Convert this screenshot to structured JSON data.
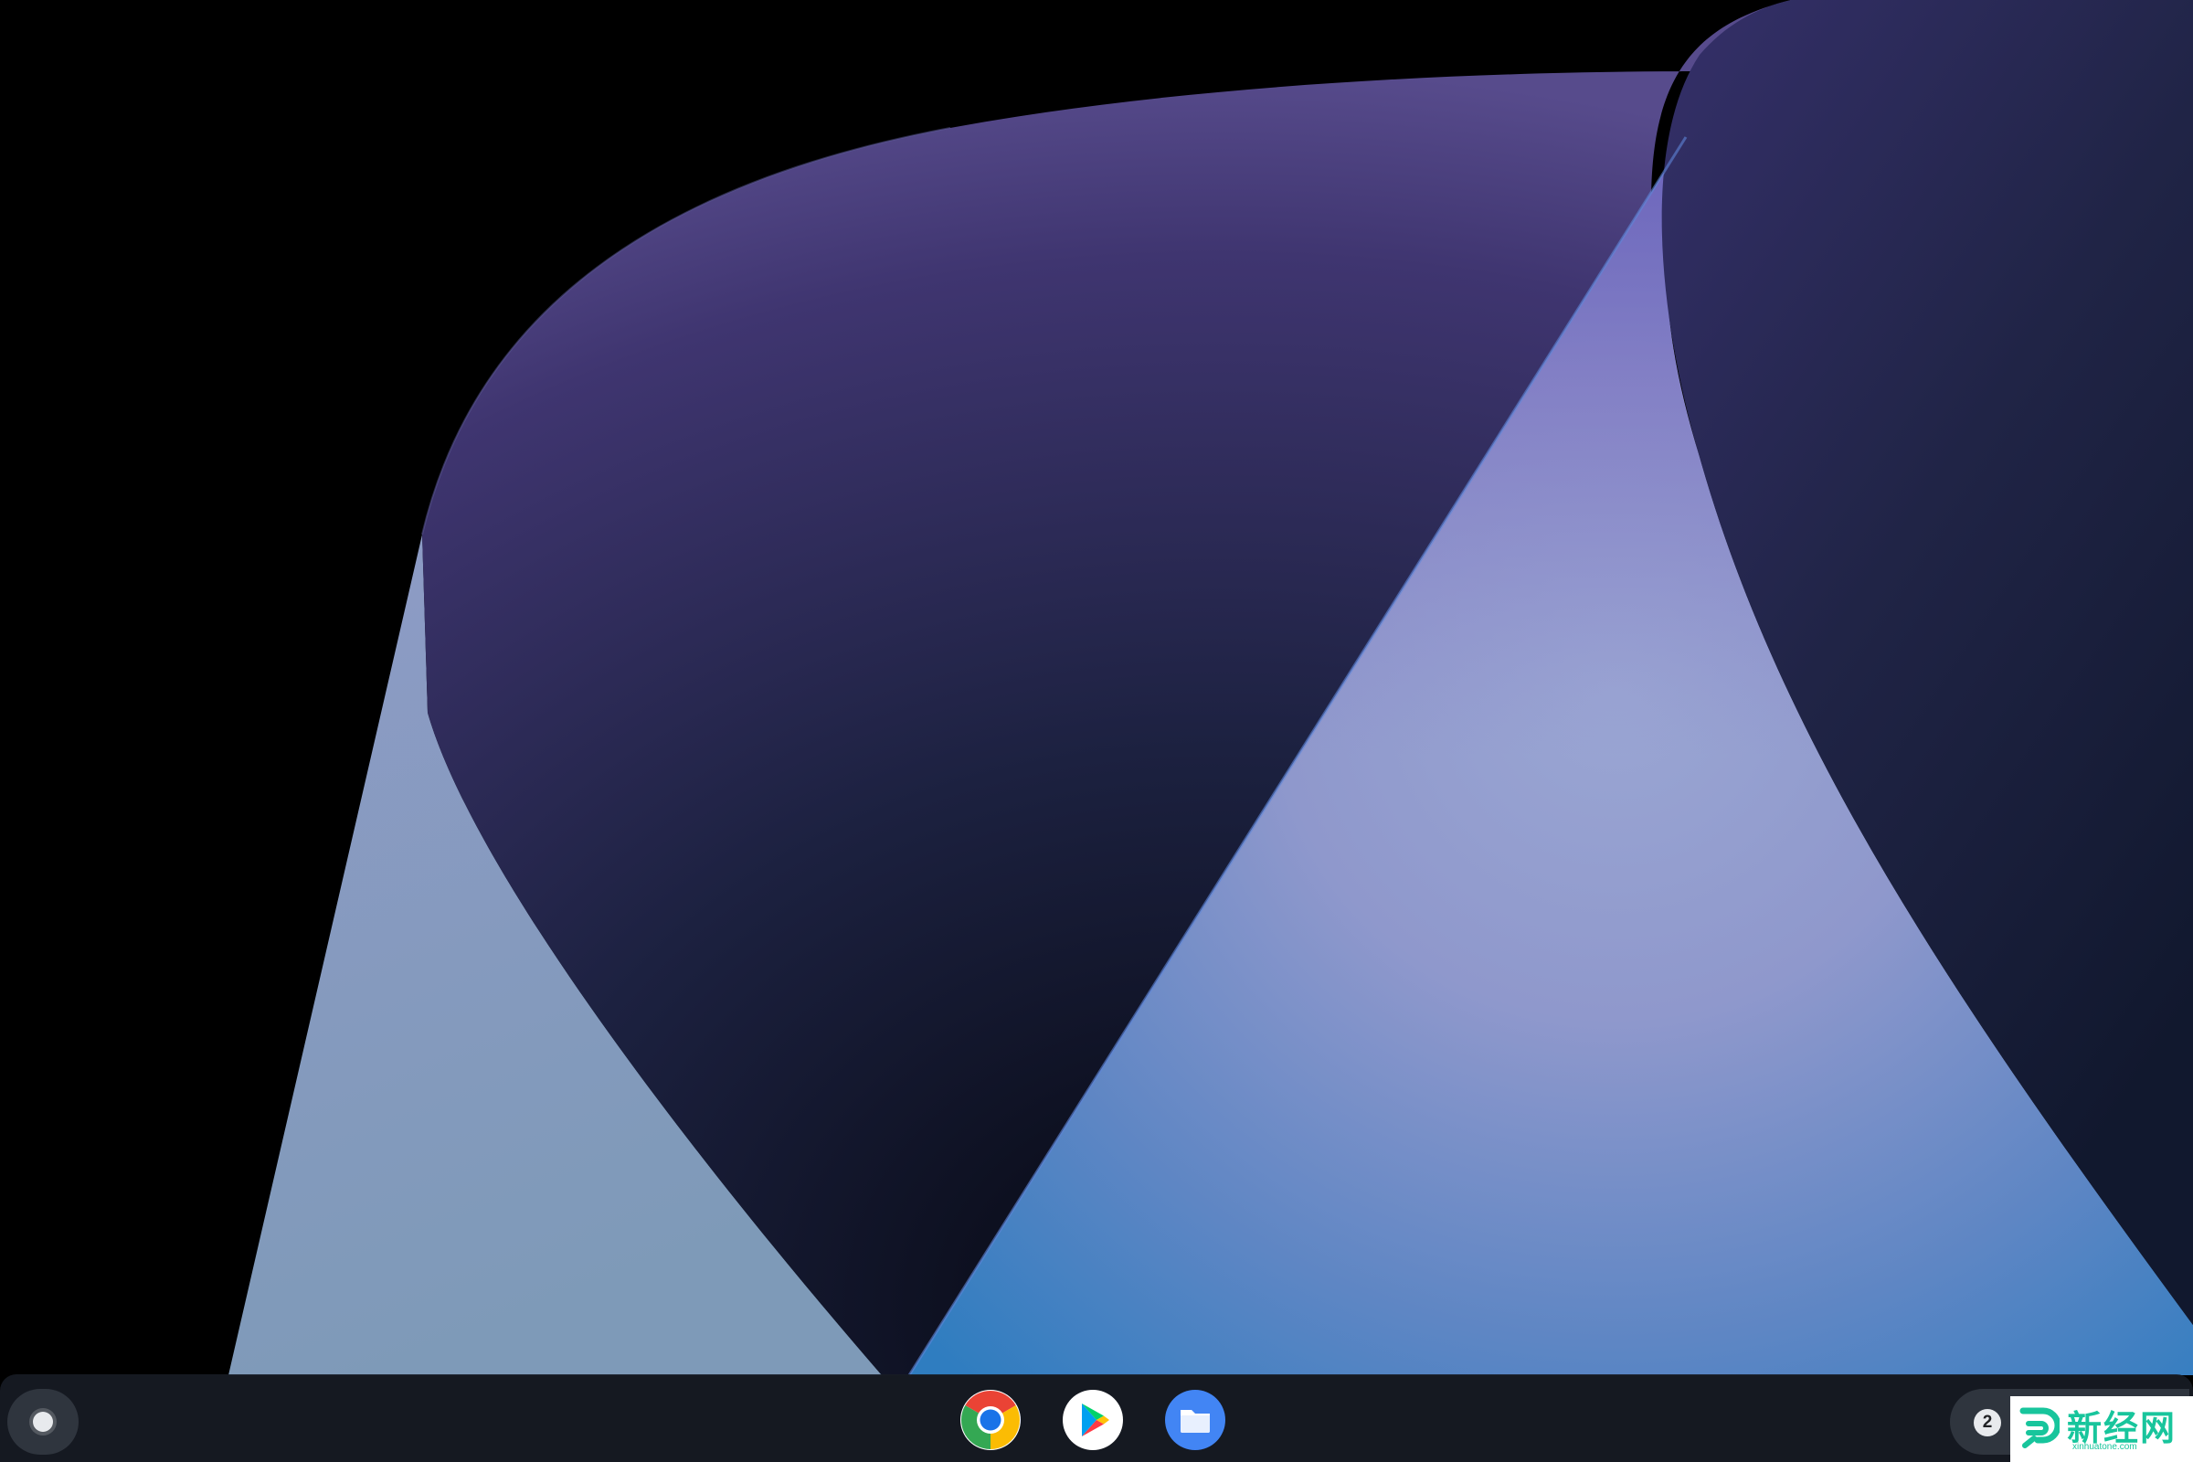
{
  "colors": {
    "background": "#000000",
    "shelf": "#181c26",
    "accent_wallpaper_violet": "#6a5fbe",
    "accent_wallpaper_blue": "#2b82c8"
  },
  "shelf": {
    "launcher": {
      "icon": "launcher-circle-icon"
    },
    "pinned_apps": [
      {
        "name": "Chrome",
        "icon": "chrome-icon"
      },
      {
        "name": "Play Store",
        "icon": "play-store-icon"
      },
      {
        "name": "Files",
        "icon": "files-folder-icon"
      }
    ],
    "status_area": {
      "notification_count": "2"
    }
  },
  "watermark": {
    "text": "新经网",
    "subtext": "xinhuatone.com"
  }
}
